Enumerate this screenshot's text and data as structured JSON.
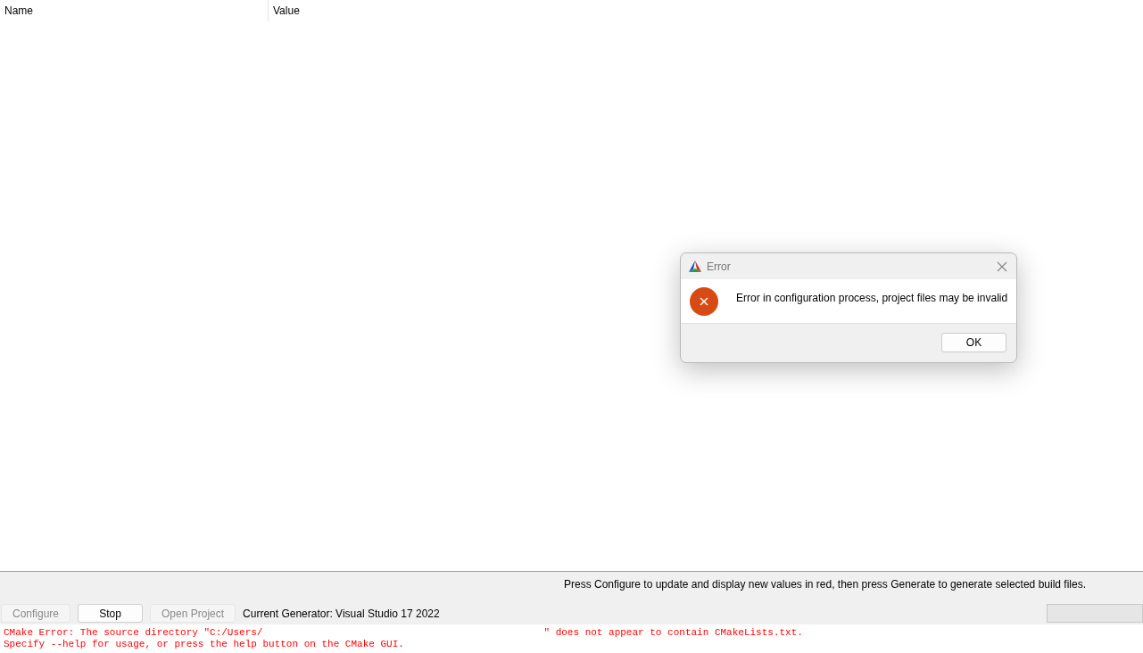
{
  "table": {
    "columns": [
      "Name",
      "Value"
    ]
  },
  "hint": "Press Configure to update and display new values in red, then press Generate to generate selected build files.",
  "buttons": [
    {
      "label": "Configure",
      "disabled": true
    },
    {
      "label": "Stop",
      "disabled": false
    },
    {
      "label": "Open Project",
      "disabled": true
    }
  ],
  "generator": "Current Generator: Visual Studio 17 2022",
  "progress": {
    "level": 0
  },
  "output": [
    [
      "CMake Error: The source directory \"C:/Users/",
      "\" does not appear to contain CMakeLists.txt."
    ],
    [
      "Specify --help for usage, or press the help button on the CMake GUI."
    ]
  ],
  "dialog": {
    "title": "Error",
    "message": "Error in configuration process, project files may be invalid",
    "button": "OK"
  }
}
